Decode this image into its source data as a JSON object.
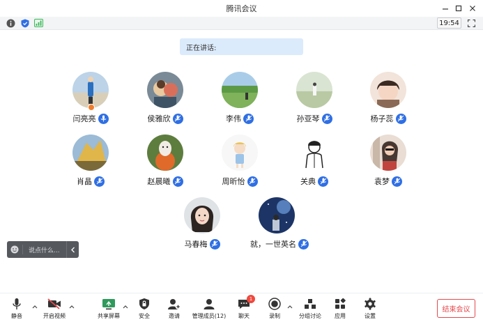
{
  "window": {
    "title": "腾讯会议"
  },
  "infobar": {
    "time": "19:54"
  },
  "speaking": {
    "label": "正在讲话:"
  },
  "participants": [
    {
      "name": "闫亮亮",
      "mic": "active",
      "host": true
    },
    {
      "name": "侯雅欣",
      "mic": "muted"
    },
    {
      "name": "李伟",
      "mic": "muted"
    },
    {
      "name": "孙亚琴",
      "mic": "muted"
    },
    {
      "name": "杨子蕊",
      "mic": "muted"
    },
    {
      "name": "肖晶",
      "mic": "muted"
    },
    {
      "name": "赵晨曦",
      "mic": "muted"
    },
    {
      "name": "周昕怡",
      "mic": "muted"
    },
    {
      "name": "关典",
      "mic": "muted"
    },
    {
      "name": "袁梦",
      "mic": "muted"
    },
    {
      "name": "马春梅",
      "mic": "muted"
    },
    {
      "name": "就，一世英名",
      "mic": "muted"
    }
  ],
  "chat": {
    "placeholder": "说点什么..."
  },
  "toolbar": {
    "mute": "静音",
    "video": "开启视频",
    "share": "共享屏幕",
    "security": "安全",
    "invite": "邀请",
    "members": "管理成员(12)",
    "chat": "聊天",
    "chat_badge": "1",
    "record": "录制",
    "breakout": "分组讨论",
    "apps": "应用",
    "settings": "设置",
    "end": "结束会议"
  },
  "colors": {
    "accent": "#2f6fe4",
    "danger": "#e5484d",
    "infobar": "#f3f4f6"
  }
}
